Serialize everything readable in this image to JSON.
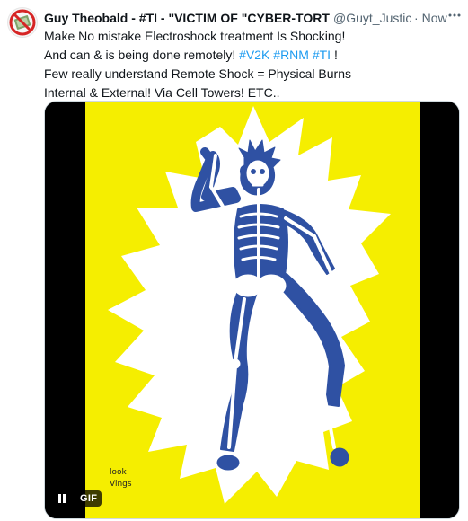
{
  "post": {
    "author": {
      "display_name": "Guy Theobald - #TI - \"VICTIM OF \"CYBER-TORTU",
      "handle": "@Guyt_Justic",
      "separator": "·",
      "timestamp": "Now"
    },
    "more_icon": "more-horizontal-icon",
    "lines": [
      {
        "text": "Make No mistake Electroshock treatment Is Shocking!"
      },
      {
        "text": "And can & is being done remotely! ",
        "hashtags": [
          "#V2K",
          "#RNM",
          "#TI"
        ],
        "trailing": " !"
      },
      {
        "text": "Few really understand Remote Shock = Physical Burns"
      },
      {
        "text": "Internal & External! Via Cell Towers! ETC.."
      }
    ],
    "media": {
      "type": "GIF",
      "badge_label": "GIF",
      "pause_icon": "pause-icon",
      "artist_signature": "look\nVings",
      "colors": {
        "background_yellow": "#f5ee00",
        "burst_white": "#ffffff",
        "skeleton_blue": "#2f51a3",
        "letterbox": "#000000"
      }
    }
  },
  "colors": {
    "hashtag": "#1d9bf0",
    "muted": "#536471"
  }
}
